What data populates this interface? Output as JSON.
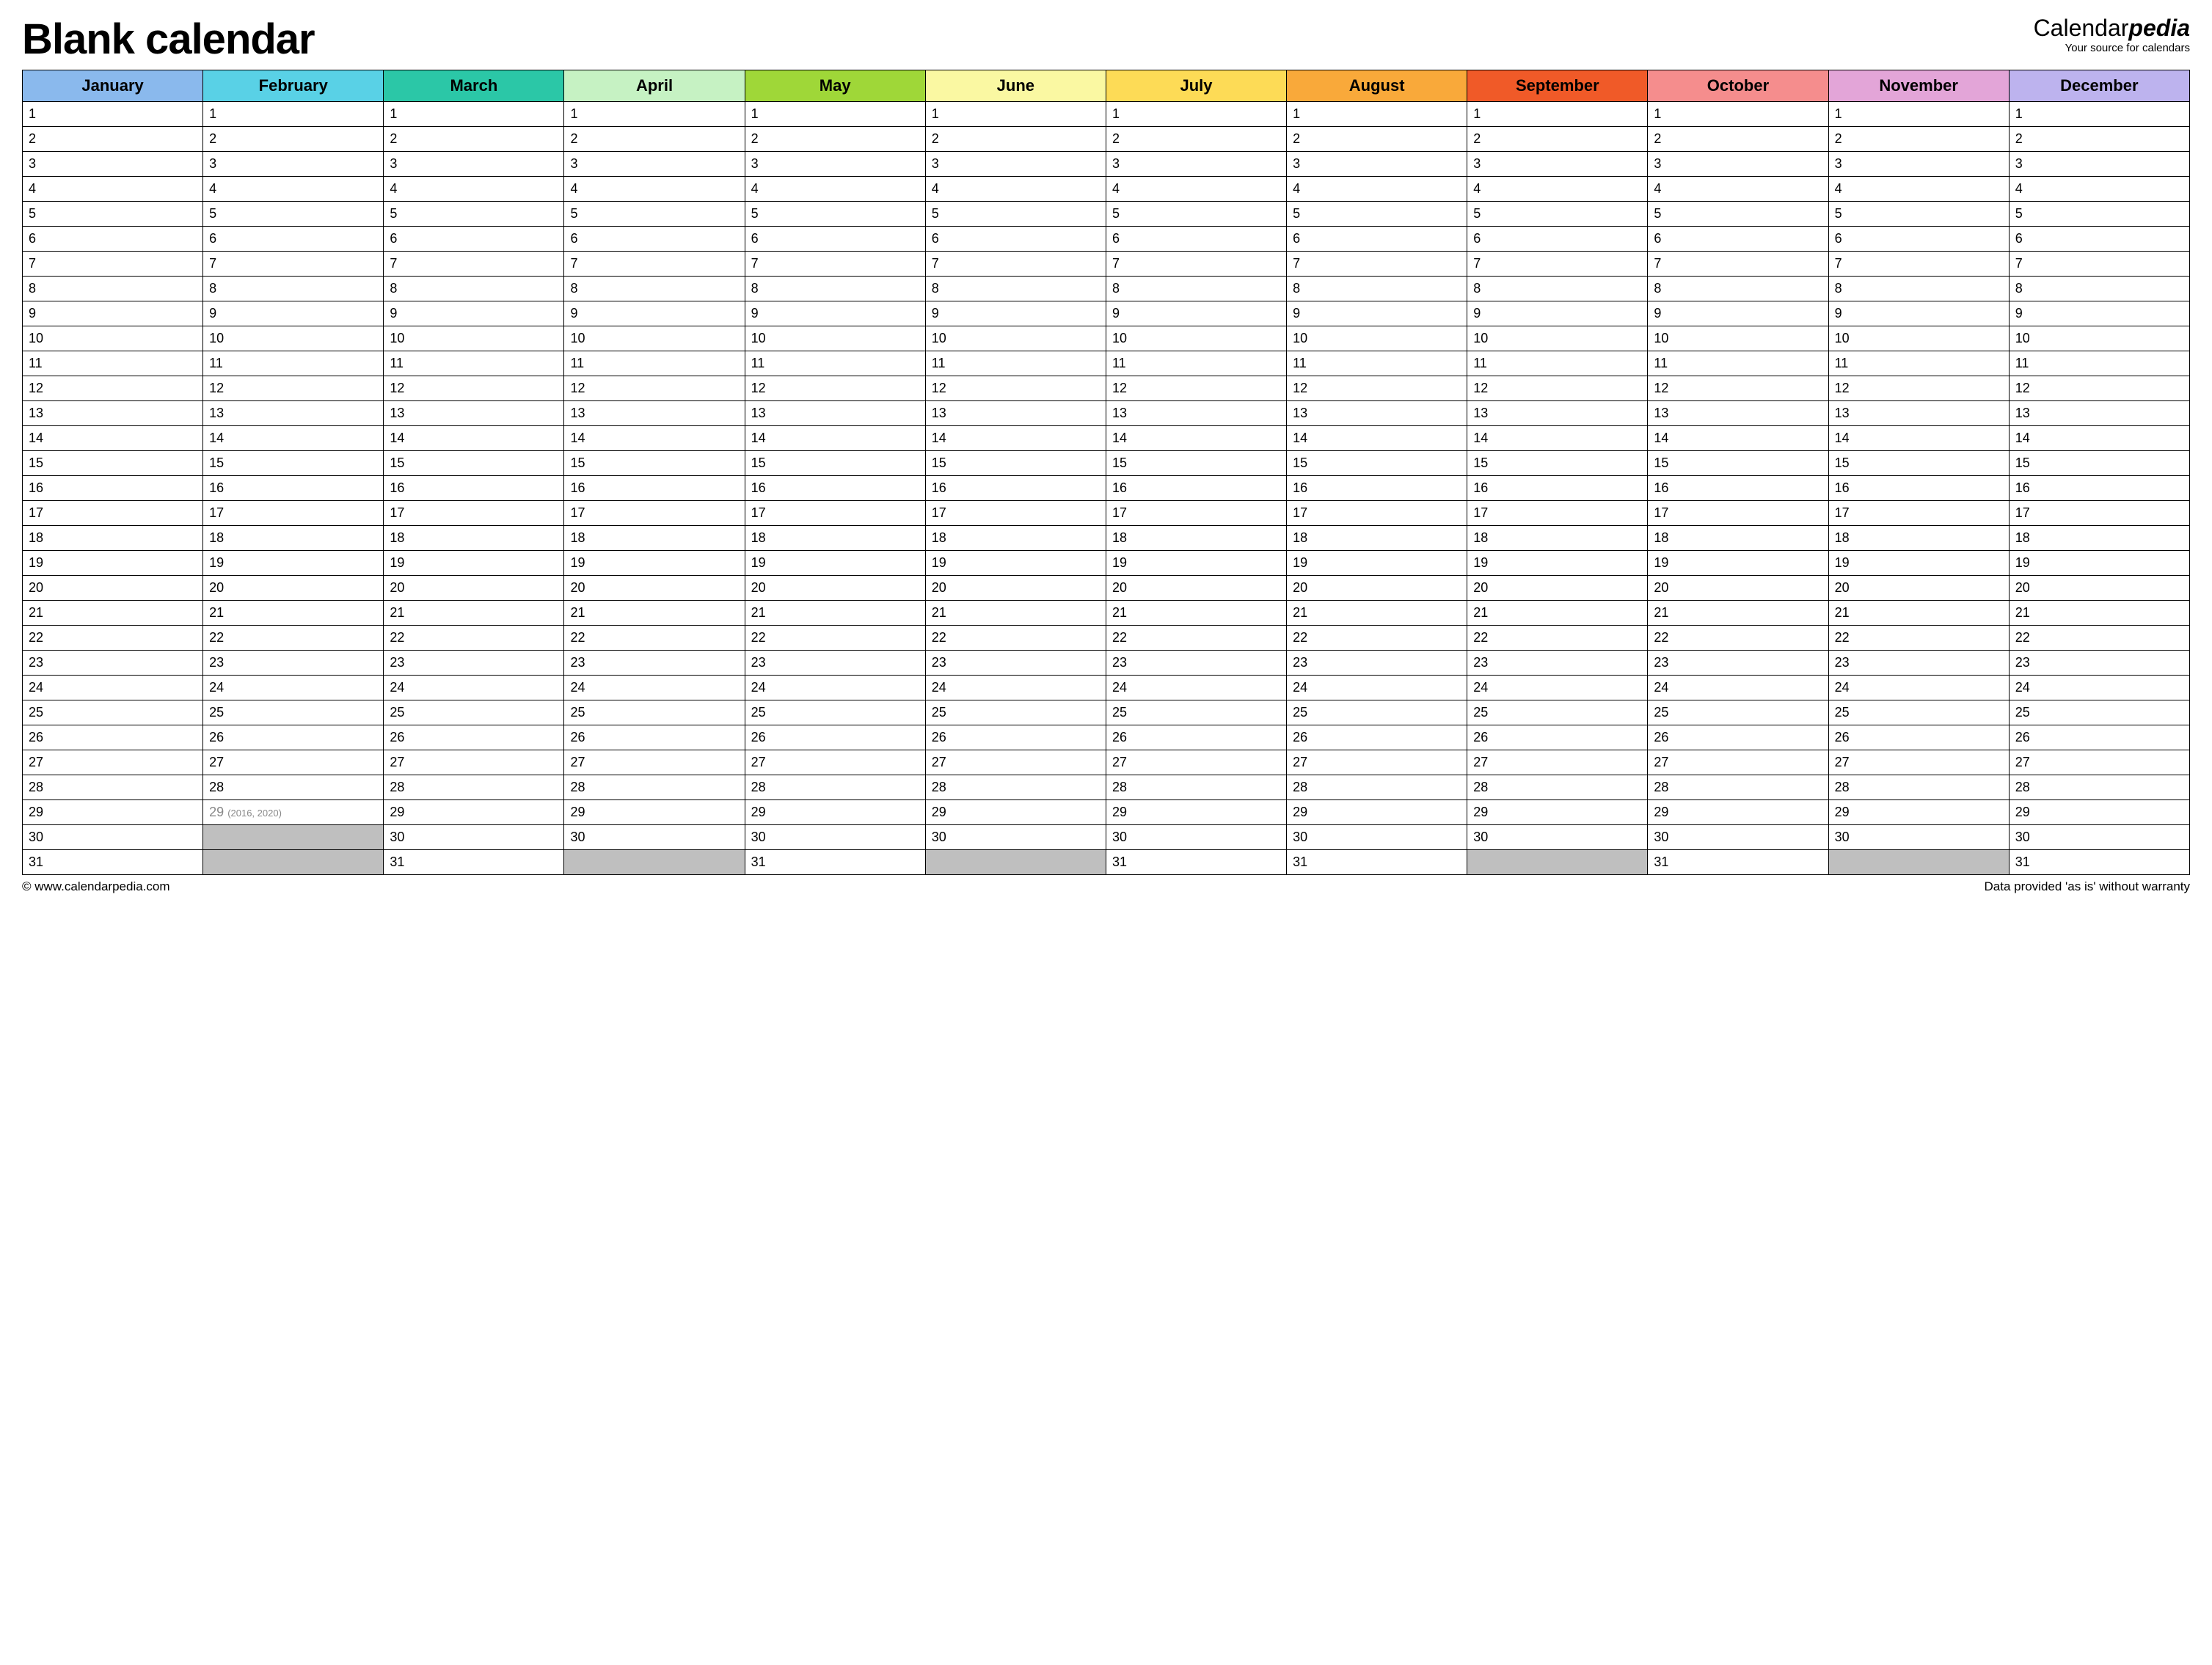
{
  "header": {
    "title": "Blank calendar",
    "brand_main": "Calendar",
    "brand_suffix": "pedia",
    "brand_tagline": "Your source for calendars"
  },
  "months": [
    {
      "name": "January",
      "color": "#8ab9ed",
      "days": 31
    },
    {
      "name": "February",
      "color": "#59d1e6",
      "days": 29,
      "leap": true,
      "leap_day": 29,
      "leap_note": "(2016, 2020)"
    },
    {
      "name": "March",
      "color": "#2bc7a7",
      "days": 31
    },
    {
      "name": "April",
      "color": "#c6f2c3",
      "days": 30
    },
    {
      "name": "May",
      "color": "#9fd738",
      "days": 31
    },
    {
      "name": "June",
      "color": "#faf8a2",
      "days": 30
    },
    {
      "name": "July",
      "color": "#fddb56",
      "days": 31
    },
    {
      "name": "August",
      "color": "#f9a93a",
      "days": 31
    },
    {
      "name": "September",
      "color": "#f05a28",
      "days": 30
    },
    {
      "name": "October",
      "color": "#f58d8d",
      "days": 31
    },
    {
      "name": "November",
      "color": "#e3a5d8",
      "days": 30
    },
    {
      "name": "December",
      "color": "#bdb3ee",
      "days": 31
    }
  ],
  "max_days": 31,
  "footer": {
    "left": "© www.calendarpedia.com",
    "right": "Data provided 'as is' without warranty"
  }
}
